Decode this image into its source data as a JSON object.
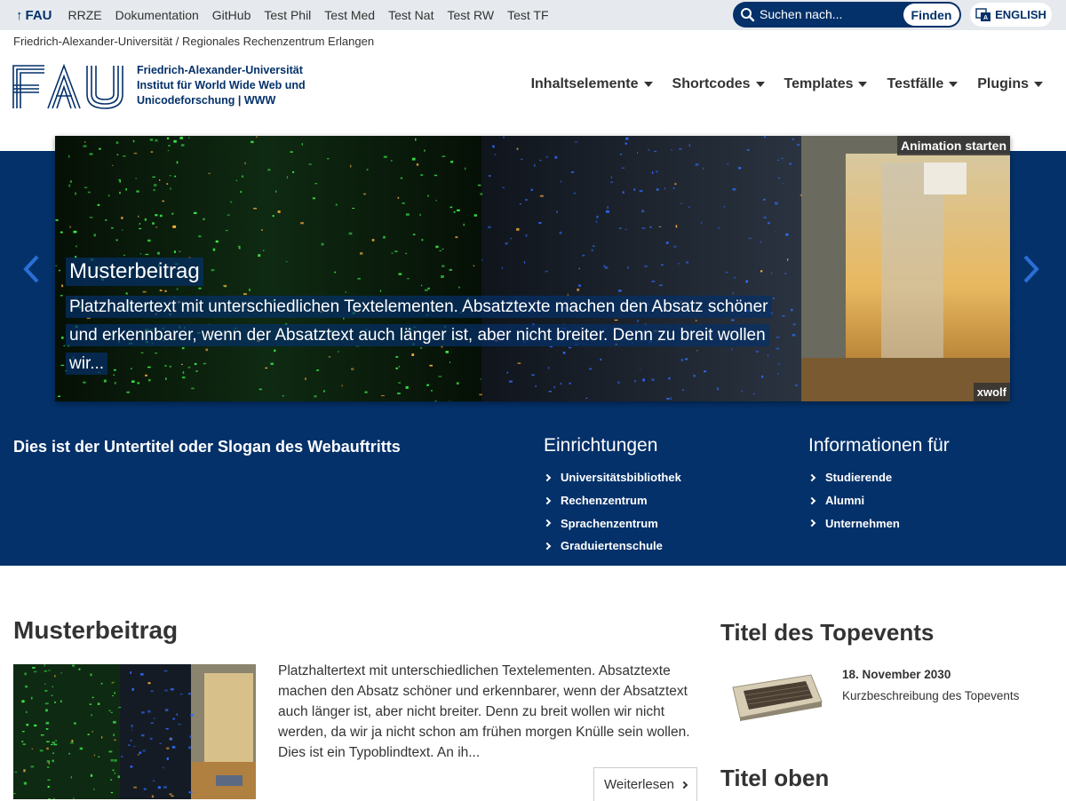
{
  "meta": {
    "fau_link": "FAU",
    "links": [
      "RRZE",
      "Dokumentation",
      "GitHub",
      "Test Phil",
      "Test Med",
      "Test Nat",
      "Test RW",
      "Test TF"
    ],
    "search_placeholder": "Suchen nach...",
    "search_button": "Finden",
    "language": "ENGLISH",
    "org_line": "Friedrich-Alexander-Universität / Regionales Rechenzentrum Erlangen"
  },
  "header": {
    "logo_text": "FAU",
    "institute": [
      "Friedrich-Alexander-Universität",
      "Institut für World Wide Web und",
      "Unicodeforschung | WWW"
    ],
    "nav": [
      "Inhaltselemente",
      "Shortcodes",
      "Templates",
      "Testfälle",
      "Plugins"
    ]
  },
  "hero": {
    "animation_button": "Animation starten",
    "credit": "xwolf",
    "caption_title": "Musterbeitrag",
    "caption_text": "Platzhaltertext mit unterschiedlichen Textelementen. Absatztexte machen den Absatz schöner und erkennbarer, wenn der Absatztext auch länger ist, aber nicht breiter. Denn zu breit wollen wir..."
  },
  "band": {
    "slogan": "Dies ist der Untertitel oder Slogan des Webauftritts",
    "einrichtungen": {
      "title": "Einrichtungen",
      "items": [
        "Universitätsbibliothek",
        "Rechenzentrum",
        "Sprachenzentrum",
        "Graduiertenschule"
      ]
    },
    "informationen": {
      "title": "Informationen für",
      "items": [
        "Studierende",
        "Alumni",
        "Unternehmen"
      ]
    }
  },
  "post": {
    "title": "Musterbeitrag",
    "text": "Platzhaltertext mit unterschiedlichen Textelementen. Absatztexte machen den Absatz schöner und erkennbarer, wenn der Absatztext auch länger ist, aber nicht breiter. Denn zu breit wollen wir nicht werden, da wir ja nicht schon am frühen morgen Knülle sein wollen. Dies ist ein Typoblindtext. An ih...",
    "more": "Weiterlesen"
  },
  "sidebar": {
    "topevents_title": "Titel des Topevents",
    "event_date": "18. November 2030",
    "event_desc": "Kurzbeschreibung des Topevents",
    "second_title": "Titel oben"
  },
  "colors": {
    "fau_blue": "#04316a",
    "metabar": "#e6eaee"
  }
}
